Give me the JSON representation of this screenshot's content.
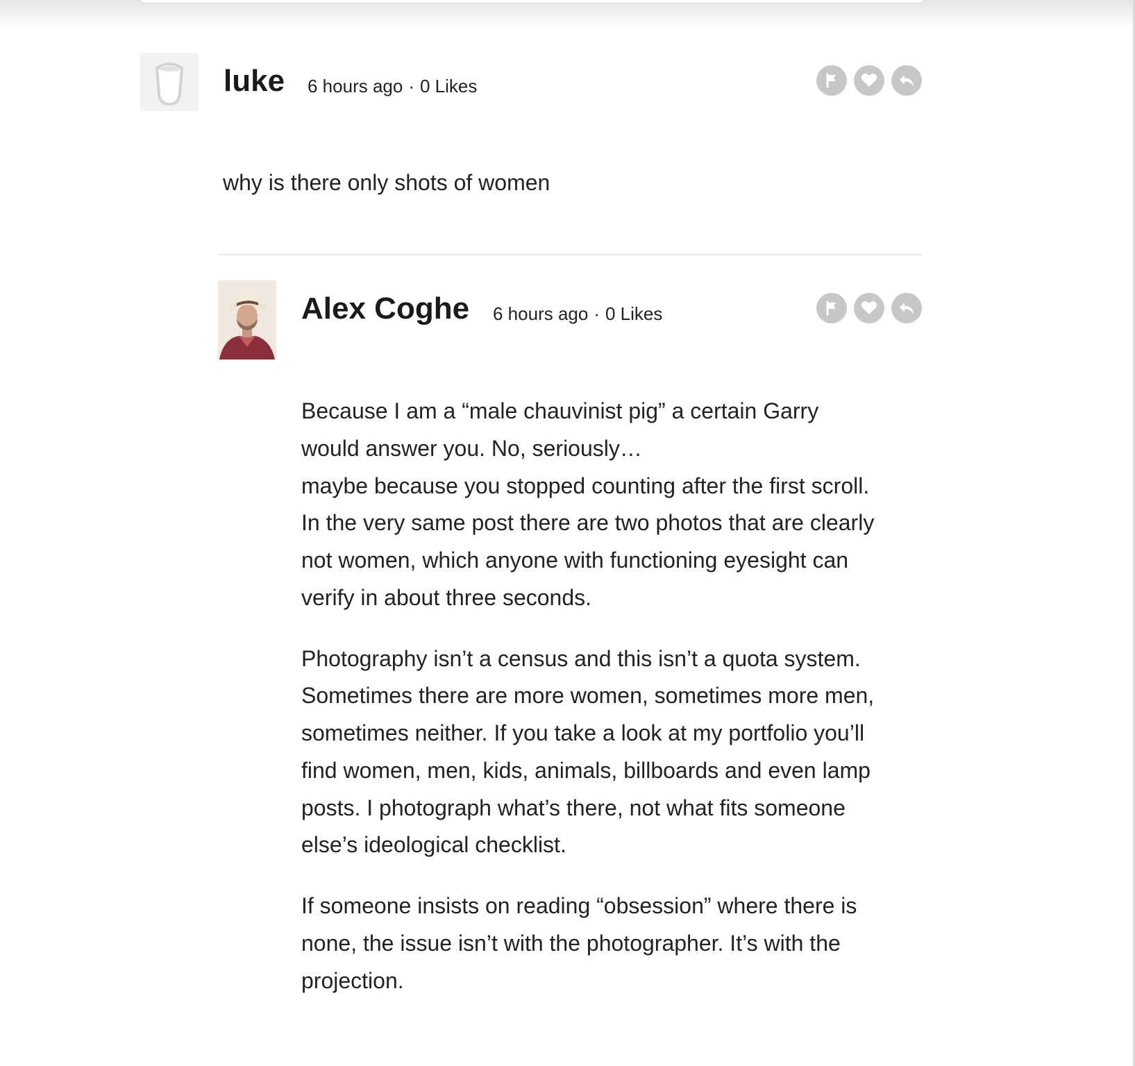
{
  "comments": [
    {
      "author": "luke",
      "time": "6 hours ago",
      "separator": "·",
      "likes": "0 Likes",
      "avatar": "default-avatar-icon",
      "body": "why is there only shots of women",
      "actions": [
        "flag-icon",
        "heart-icon",
        "reply-icon"
      ]
    },
    {
      "author": "Alex Coghe",
      "time": "6 hours ago",
      "separator": "·",
      "likes": "0 Likes",
      "avatar": "user-photo",
      "paragraphs": [
        [
          "Because I am a “male chauvinist pig” a certain Garry",
          "would answer you. No, seriously…",
          "maybe because you stopped counting after the first scroll.",
          "In the very same post there are two photos that are clearly",
          "not women, which anyone with functioning eyesight can",
          "verify in about three seconds."
        ],
        [
          "Photography isn’t a census and this isn’t a quota system.",
          "Sometimes there are more women, sometimes more men,",
          "sometimes neither. If you take a look at my portfolio you’ll",
          "find women, men, kids, animals, billboards and even lamp",
          "posts. I photograph what’s there, not what fits someone",
          "else’s ideological checklist."
        ],
        [
          "If someone insists on reading “obsession” where there is",
          "none, the issue isn’t with the photographer. It’s with the",
          "projection."
        ]
      ],
      "actions": [
        "flag-icon",
        "heart-icon",
        "reply-icon"
      ]
    }
  ],
  "colors": {
    "text": "#1e1e1e",
    "action_button": "#c7c7c7",
    "divider": "#e7e7e7"
  }
}
